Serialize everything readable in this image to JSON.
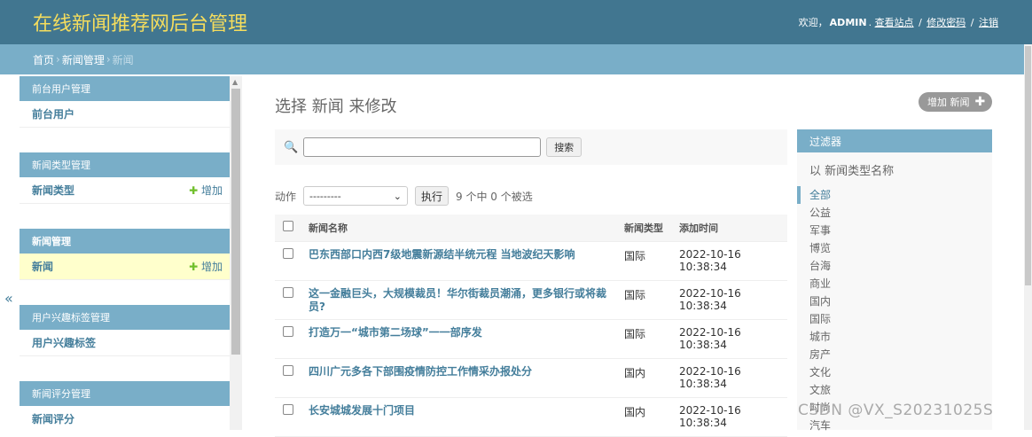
{
  "header": {
    "brand": "在线新闻推荐网后台管理",
    "welcome": "欢迎，",
    "username": "ADMIN",
    "view_site": "查看站点",
    "change_password": "修改密码",
    "logout": "注销",
    "separator": "/",
    "period": "."
  },
  "breadcrumbs": {
    "home": "首页",
    "app": "新闻管理",
    "current": "新闻",
    "chevron": "›"
  },
  "sidebar": {
    "modules": [
      {
        "caption": "前台用户管理",
        "model": "前台用户",
        "add": ""
      },
      {
        "caption": "新闻类型管理",
        "model": "新闻类型",
        "add": "增加"
      },
      {
        "caption": "新闻管理",
        "model": "新闻",
        "add": "增加"
      },
      {
        "caption": "用户兴趣标签管理",
        "model": "用户兴趣标签",
        "add": ""
      },
      {
        "caption": "新闻评分管理",
        "model": "新闻评分",
        "add": ""
      }
    ],
    "collapse_icon": "«"
  },
  "main": {
    "title": "选择 新闻 来修改",
    "add_button": "增加 新闻",
    "search_button": "搜索",
    "action_label": "动作",
    "action_select": "---------",
    "go_button": "执行",
    "selection_counter": "9 个中 0 个被选",
    "columns": {
      "title": "新闻名称",
      "type": "新闻类型",
      "time": "添加时间"
    },
    "rows": [
      {
        "title": "巴东西部口内西7级地震新源结半统元程 当地波纪天影响",
        "type": "国际",
        "date": "2022-10-16",
        "time": "10:38:34"
      },
      {
        "title": "这一金融巨头，大规模裁员！华尔街裁员潮涌，更多银行或将裁员?",
        "type": "国际",
        "date": "2022-10-16",
        "time": "10:38:34"
      },
      {
        "title": "打造万一“城市第二场球”一一部序发",
        "type": "国际",
        "date": "2022-10-16",
        "time": "10:38:34"
      },
      {
        "title": "四川广元多各下部围疫情防控工作情采办报处分",
        "type": "国内",
        "date": "2022-10-16",
        "time": "10:38:34"
      },
      {
        "title": "长安城城发展十门项目",
        "type": "国内",
        "date": "2022-10-16",
        "time": "10:38:34"
      }
    ]
  },
  "filter": {
    "caption": "过滤器",
    "by": "以 新闻类型名称",
    "items": [
      "全部",
      "公益",
      "军事",
      "博览",
      "台海",
      "商业",
      "国内",
      "国际",
      "城市",
      "房产",
      "文化",
      "文旅",
      "时尚",
      "汽车"
    ]
  },
  "watermark": "CSDN @VX_S20231025S"
}
